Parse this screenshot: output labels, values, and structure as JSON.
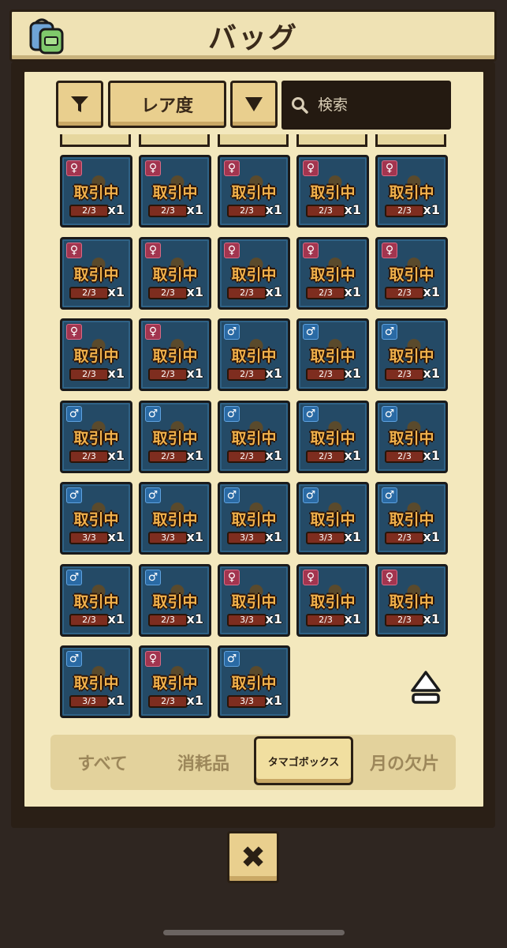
{
  "header": {
    "title": "バッグ",
    "icon": "backpack-icon"
  },
  "toolbar": {
    "filter_icon": "filter-icon",
    "sort_label": "レア度",
    "sort_toggle_icon": "triangle-down-icon",
    "search_placeholder": "検索",
    "search_icon": "search-icon"
  },
  "items": [
    {
      "gender": "female",
      "status": "取引中",
      "progress": "2/3",
      "count": "x1"
    },
    {
      "gender": "female",
      "status": "取引中",
      "progress": "2/3",
      "count": "x1"
    },
    {
      "gender": "female",
      "status": "取引中",
      "progress": "2/3",
      "count": "x1"
    },
    {
      "gender": "female",
      "status": "取引中",
      "progress": "2/3",
      "count": "x1"
    },
    {
      "gender": "female",
      "status": "取引中",
      "progress": "2/3",
      "count": "x1"
    },
    {
      "gender": "female",
      "status": "取引中",
      "progress": "2/3",
      "count": "x1"
    },
    {
      "gender": "female",
      "status": "取引中",
      "progress": "2/3",
      "count": "x1"
    },
    {
      "gender": "female",
      "status": "取引中",
      "progress": "2/3",
      "count": "x1"
    },
    {
      "gender": "female",
      "status": "取引中",
      "progress": "2/3",
      "count": "x1"
    },
    {
      "gender": "female",
      "status": "取引中",
      "progress": "2/3",
      "count": "x1"
    },
    {
      "gender": "female",
      "status": "取引中",
      "progress": "2/3",
      "count": "x1"
    },
    {
      "gender": "female",
      "status": "取引中",
      "progress": "2/3",
      "count": "x1"
    },
    {
      "gender": "male",
      "status": "取引中",
      "progress": "2/3",
      "count": "x1"
    },
    {
      "gender": "male",
      "status": "取引中",
      "progress": "2/3",
      "count": "x1"
    },
    {
      "gender": "male",
      "status": "取引中",
      "progress": "2/3",
      "count": "x1"
    },
    {
      "gender": "male",
      "status": "取引中",
      "progress": "2/3",
      "count": "x1"
    },
    {
      "gender": "male",
      "status": "取引中",
      "progress": "2/3",
      "count": "x1"
    },
    {
      "gender": "male",
      "status": "取引中",
      "progress": "2/3",
      "count": "x1"
    },
    {
      "gender": "male",
      "status": "取引中",
      "progress": "2/3",
      "count": "x1"
    },
    {
      "gender": "male",
      "status": "取引中",
      "progress": "2/3",
      "count": "x1"
    },
    {
      "gender": "male",
      "status": "取引中",
      "progress": "3/3",
      "count": "x1"
    },
    {
      "gender": "male",
      "status": "取引中",
      "progress": "3/3",
      "count": "x1"
    },
    {
      "gender": "male",
      "status": "取引中",
      "progress": "3/3",
      "count": "x1"
    },
    {
      "gender": "male",
      "status": "取引中",
      "progress": "3/3",
      "count": "x1"
    },
    {
      "gender": "male",
      "status": "取引中",
      "progress": "2/3",
      "count": "x1"
    },
    {
      "gender": "male",
      "status": "取引中",
      "progress": "2/3",
      "count": "x1"
    },
    {
      "gender": "male",
      "status": "取引中",
      "progress": "2/3",
      "count": "x1"
    },
    {
      "gender": "female",
      "status": "取引中",
      "progress": "3/3",
      "count": "x1"
    },
    {
      "gender": "female",
      "status": "取引中",
      "progress": "2/3",
      "count": "x1"
    },
    {
      "gender": "female",
      "status": "取引中",
      "progress": "2/3",
      "count": "x1"
    },
    {
      "gender": "male",
      "status": "取引中",
      "progress": "3/3",
      "count": "x1"
    },
    {
      "gender": "female",
      "status": "取引中",
      "progress": "2/3",
      "count": "x1"
    },
    {
      "gender": "male",
      "status": "取引中",
      "progress": "3/3",
      "count": "x1"
    }
  ],
  "scroll_top_icon": "eject-arrow-icon",
  "tabs": [
    {
      "label": "すべて",
      "active": false
    },
    {
      "label": "消耗品",
      "active": false
    },
    {
      "label": "タマゴボックス",
      "active": true
    },
    {
      "label": "月の欠片",
      "active": false
    }
  ],
  "close_icon": "close-icon",
  "close_label": "✖",
  "colors": {
    "parchment": "#f3e8bd",
    "tile_bg": "#244a66",
    "status_orange": "#f1b14b",
    "female_badge": "#a2354f",
    "male_badge": "#2a6aa4"
  }
}
